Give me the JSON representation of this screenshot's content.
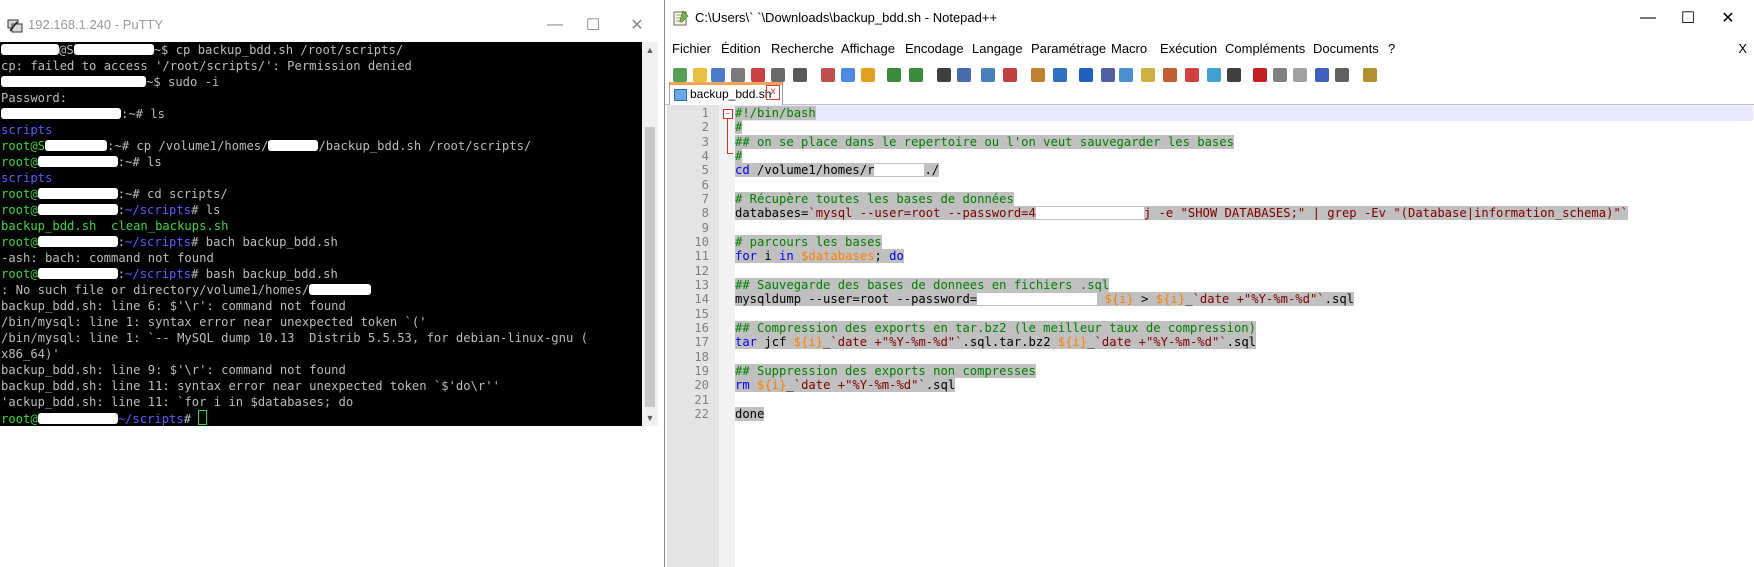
{
  "putty": {
    "title": "192.168.1.240 - PuTTY",
    "lines": [
      [
        {
          "t": "",
          "r": 58
        },
        {
          "t": "@S"
        },
        {
          "t": "",
          "r": 80
        },
        {
          "t": "~$ cp backup_bdd.sh /root/scripts/"
        }
      ],
      [
        {
          "t": "cp: failed to access '/root/scripts/': Permission denied"
        }
      ],
      [
        {
          "t": "",
          "r": 145
        },
        {
          "t": "~$ sudo -i"
        }
      ],
      [
        {
          "t": "Password:"
        }
      ],
      [
        {
          "t": "",
          "r": 120
        },
        {
          "t": ":~# ls"
        }
      ],
      [
        {
          "t": "scripts",
          "c": "b"
        }
      ],
      [
        {
          "t": "root@S",
          "c": "g"
        },
        {
          "t": "",
          "r": 62
        },
        {
          "t": ":~# cp /volume1/homes/"
        },
        {
          "t": "",
          "r": 50
        },
        {
          "t": "/backup_bdd.sh /root/scripts/"
        }
      ],
      [
        {
          "t": "root@",
          "c": "g"
        },
        {
          "t": "",
          "r": 80
        },
        {
          "t": ":~# ls"
        }
      ],
      [
        {
          "t": "scripts",
          "c": "b"
        }
      ],
      [
        {
          "t": "root@",
          "c": "g"
        },
        {
          "t": "",
          "r": 80
        },
        {
          "t": ":~# cd scripts/"
        }
      ],
      [
        {
          "t": "root@",
          "c": "g"
        },
        {
          "t": "",
          "r": 80
        },
        {
          "t": ":~/scripts# ls",
          "c": "b2"
        }
      ],
      [
        {
          "t": "backup_bdd.sh  clean_backups.sh",
          "c": "g"
        }
      ],
      [
        {
          "t": "root@",
          "c": "g"
        },
        {
          "t": "",
          "r": 80
        },
        {
          "t": ":~/scripts# bach backup_bdd.sh",
          "c": "b2"
        }
      ],
      [
        {
          "t": "-ash: bach: command not found"
        }
      ],
      [
        {
          "t": "root@",
          "c": "g"
        },
        {
          "t": "",
          "r": 80
        },
        {
          "t": ":~/scripts# bash backup_bdd.sh",
          "c": "b2"
        }
      ],
      [
        {
          "t": ": No such file or directory/volume1/homes/"
        },
        {
          "t": "",
          "r": 62
        }
      ],
      [
        {
          "t": "backup_bdd.sh: line 6: $'\\r': command not found"
        }
      ],
      [
        {
          "t": "/bin/mysql: line 1: syntax error near unexpected token `('"
        }
      ],
      [
        {
          "t": "/bin/mysql: line 1: `-- MySQL dump 10.13  Distrib 5.5.53, for debian-linux-gnu ("
        }
      ],
      [
        {
          "t": "x86_64)'"
        }
      ],
      [
        {
          "t": "backup_bdd.sh: line 9: $'\\r': command not found"
        }
      ],
      [
        {
          "t": "backup_bdd.sh: line 11: syntax error near unexpected token `$'do\\r''"
        }
      ],
      [
        {
          "t": "'ackup_bdd.sh: line 11: `for i in $databases; do"
        }
      ],
      [
        {
          "t": "root@",
          "c": "g"
        },
        {
          "t": "",
          "r": 80
        },
        {
          "t": "~/scripts# ",
          "c": "b2"
        },
        {
          "t": "",
          "cur": true
        }
      ]
    ]
  },
  "npp": {
    "title": "C:\\Users\\`  `\\Downloads\\backup_bdd.sh - Notepad++",
    "menu": [
      "Fichier",
      "Édition",
      "Recherche",
      "Affichage",
      "Encodage",
      "Langage",
      "Paramétrage",
      "Macro",
      "Exécution",
      "Compléments",
      "Documents",
      "?"
    ],
    "menu_close": "X",
    "tab_label": "backup_bdd.sh",
    "tab_close": "x",
    "lines": [
      [
        {
          "t": "#!/bin/bash",
          "c": "cm"
        }
      ],
      [
        {
          "t": "#",
          "c": "cm"
        }
      ],
      [
        {
          "t": "## on se place dans le repertoire ou l'on veut sauvegarder les bases",
          "c": "cm"
        }
      ],
      [
        {
          "t": "#",
          "c": "cm"
        }
      ],
      [
        {
          "t": "cd",
          "c": "kw"
        },
        {
          "t": " /volume1/homes/r"
        },
        {
          "t": "",
          "r": 50
        },
        {
          "t": "./"
        }
      ],
      [],
      [
        {
          "t": "# Récupère toutes les bases de données",
          "c": "cm"
        }
      ],
      [
        {
          "t": "databases="
        },
        {
          "t": "`mysql --user=root --password=4",
          "c": "st"
        },
        {
          "t": "",
          "r": 108
        },
        {
          "t": "j -e \"SHOW DATABASES;\" | grep -Ev \"(Database|information_schema)\"`",
          "c": "st"
        }
      ],
      [],
      [
        {
          "t": "# parcours les bases",
          "c": "cm"
        }
      ],
      [
        {
          "t": "for",
          "c": "kw"
        },
        {
          "t": " i "
        },
        {
          "t": "in",
          "c": "kw"
        },
        {
          "t": " "
        },
        {
          "t": "$databases",
          "c": "vv"
        },
        {
          "t": "; "
        },
        {
          "t": "do",
          "c": "kw"
        }
      ],
      [],
      [
        {
          "t": "## Sauvegarde des bases de donnees en fichiers .sql",
          "c": "cm"
        }
      ],
      [
        {
          "t": "mysqldump --user=root --password="
        },
        {
          "t": "",
          "r": 120
        },
        {
          "t": " "
        },
        {
          "t": "${i}",
          "c": "vv"
        },
        {
          "t": " > "
        },
        {
          "t": "${i}",
          "c": "vv"
        },
        {
          "t": "_"
        },
        {
          "t": "`date +\"%Y-%m-%d\"`",
          "c": "st"
        },
        {
          "t": ".sql"
        }
      ],
      [],
      [
        {
          "t": "## Compression des exports en tar.bz2 (le meilleur taux de compression)",
          "c": "cm"
        }
      ],
      [
        {
          "t": "tar",
          "c": "kw"
        },
        {
          "t": " jcf "
        },
        {
          "t": "${i}",
          "c": "vv"
        },
        {
          "t": "_"
        },
        {
          "t": "`date +\"%Y-%m-%d\"`",
          "c": "st"
        },
        {
          "t": ".sql.tar.bz2 "
        },
        {
          "t": "${i}",
          "c": "vv"
        },
        {
          "t": "_"
        },
        {
          "t": "`date +\"%Y-%m-%d\"`",
          "c": "st"
        },
        {
          "t": ".sql"
        }
      ],
      [],
      [
        {
          "t": "## Suppression des exports non compresses",
          "c": "cm"
        }
      ],
      [
        {
          "t": "rm",
          "c": "kw"
        },
        {
          "t": " "
        },
        {
          "t": "${i}",
          "c": "vv"
        },
        {
          "t": "_"
        },
        {
          "t": "`date +\"%Y-%m-%d\"`",
          "c": "st"
        },
        {
          "t": ".sql"
        }
      ],
      [],
      [
        {
          "t": "done",
          "c": "kw2"
        }
      ]
    ]
  }
}
